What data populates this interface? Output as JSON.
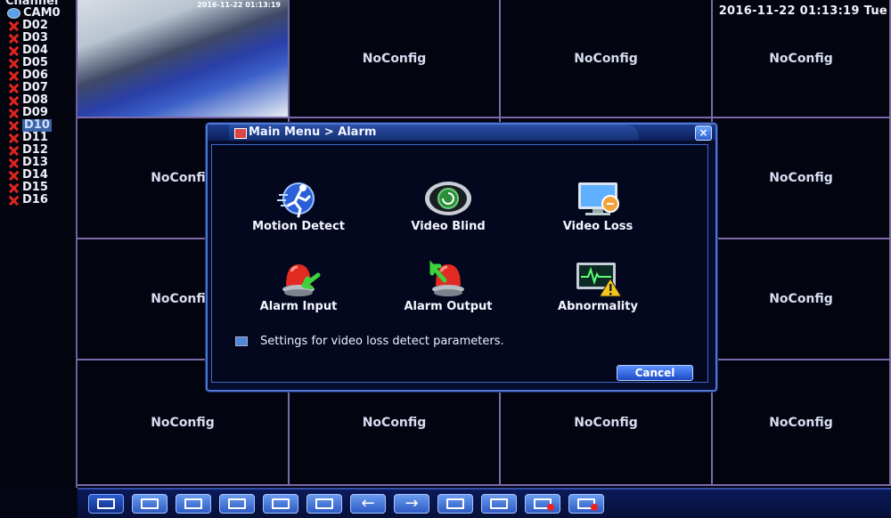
{
  "sidebar": {
    "header": "Channel",
    "channels": [
      {
        "label": "CAM0",
        "status": "camera"
      },
      {
        "label": "D02",
        "status": "no-signal"
      },
      {
        "label": "D03",
        "status": "no-signal"
      },
      {
        "label": "D04",
        "status": "no-signal"
      },
      {
        "label": "D05",
        "status": "no-signal"
      },
      {
        "label": "D06",
        "status": "no-signal"
      },
      {
        "label": "D07",
        "status": "no-signal"
      },
      {
        "label": "D08",
        "status": "no-signal"
      },
      {
        "label": "D09",
        "status": "no-signal"
      },
      {
        "label": "D10",
        "status": "selected"
      },
      {
        "label": "D11",
        "status": "no-signal"
      },
      {
        "label": "D12",
        "status": "no-signal"
      },
      {
        "label": "D13",
        "status": "no-signal"
      },
      {
        "label": "D14",
        "status": "no-signal"
      },
      {
        "label": "D15",
        "status": "no-signal"
      },
      {
        "label": "D16",
        "status": "no-signal"
      }
    ]
  },
  "datetime": "2016-11-22 01:13:19 Tue",
  "grid": {
    "cells": [
      "",
      "NoConfig",
      "NoConfig",
      "NoConfig",
      "NoConfig",
      "",
      "",
      "NoConfig",
      "NoConfig",
      "",
      "",
      "NoConfig",
      "NoConfig",
      "NoConfig",
      "NoConfig",
      "NoConfig"
    ],
    "camera_timestamp": "2016-11-22 01:13:19"
  },
  "dialog": {
    "title": "Main Menu > Alarm",
    "close_label": "×",
    "items": [
      {
        "label": "Motion Detect",
        "icon": "running-man-icon"
      },
      {
        "label": "Video Blind",
        "icon": "lens-blind-icon"
      },
      {
        "label": "Video Loss",
        "icon": "monitor-loss-icon"
      },
      {
        "label": "Alarm Input",
        "icon": "alarm-light-in-icon"
      },
      {
        "label": "Alarm Output",
        "icon": "alarm-light-out-icon"
      },
      {
        "label": "Abnormality",
        "icon": "monitor-warning-icon"
      }
    ],
    "hint": "Settings for video loss detect parameters.",
    "cancel_label": "Cancel"
  },
  "toolbar": {
    "buttons": [
      "layout-1-icon",
      "layout-4-icon",
      "layout-8-icon",
      "layout-9-icon",
      "layout-16-icon",
      "fullscreen-icon",
      "prev-arrow-icon",
      "next-arrow-icon",
      "playback-icon",
      "tour-icon",
      "record-icon",
      "stop-record-icon"
    ]
  },
  "colors": {
    "accent": "#2d5bc4",
    "grid_line": "#7d6aa8",
    "alert_red": "#e0241f"
  }
}
